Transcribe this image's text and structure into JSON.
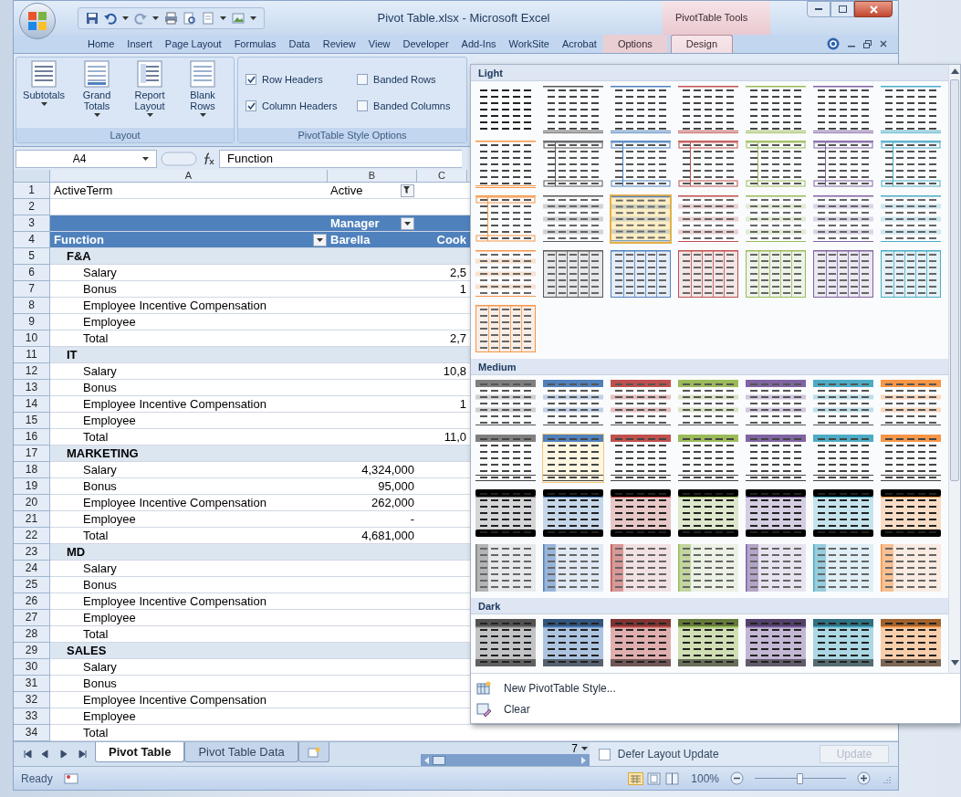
{
  "window": {
    "title": "Pivot Table.xlsx - Microsoft Excel",
    "context_title": "PivotTable Tools"
  },
  "tabs": [
    {
      "label": "Home",
      "selected": false,
      "contextual": false
    },
    {
      "label": "Insert",
      "selected": false,
      "contextual": false
    },
    {
      "label": "Page Layout",
      "selected": false,
      "contextual": false
    },
    {
      "label": "Formulas",
      "selected": false,
      "contextual": false
    },
    {
      "label": "Data",
      "selected": false,
      "contextual": false
    },
    {
      "label": "Review",
      "selected": false,
      "contextual": false
    },
    {
      "label": "View",
      "selected": false,
      "contextual": false
    },
    {
      "label": "Developer",
      "selected": false,
      "contextual": false
    },
    {
      "label": "Add-Ins",
      "selected": false,
      "contextual": false
    },
    {
      "label": "WorkSite",
      "selected": false,
      "contextual": false
    },
    {
      "label": "Acrobat",
      "selected": false,
      "contextual": false
    },
    {
      "label": "Options",
      "selected": false,
      "contextual": true
    },
    {
      "label": "Design",
      "selected": true,
      "contextual": true
    }
  ],
  "ribbon": {
    "layout_group": {
      "title": "Layout",
      "buttons": [
        {
          "label": "Subtotals"
        },
        {
          "label": "Grand Totals"
        },
        {
          "label": "Report Layout"
        },
        {
          "label": "Blank Rows"
        }
      ]
    },
    "style_options": {
      "title": "PivotTable Style Options",
      "options": [
        {
          "label": "Row Headers",
          "checked": true
        },
        {
          "label": "Banded Rows",
          "checked": false
        },
        {
          "label": "Column Headers",
          "checked": true
        },
        {
          "label": "Banded Columns",
          "checked": false
        }
      ]
    }
  },
  "formula_bar": {
    "name_box": "A4",
    "value": "Function"
  },
  "columns": [
    "A",
    "B",
    "C"
  ],
  "rows": [
    {
      "number": "1",
      "kind": "filter",
      "a": "ActiveTerm",
      "b": "Active"
    },
    {
      "number": "2",
      "kind": "blank"
    },
    {
      "number": "3",
      "kind": "header-top",
      "b": "Manager"
    },
    {
      "number": "4",
      "kind": "header",
      "a": "Function",
      "b": "Barella",
      "c": "Cook"
    },
    {
      "number": "5",
      "kind": "group",
      "a": "F&A"
    },
    {
      "number": "6",
      "kind": "item",
      "a": "Salary",
      "c": "2,5"
    },
    {
      "number": "7",
      "kind": "item",
      "a": "Bonus",
      "c": "1"
    },
    {
      "number": "8",
      "kind": "item",
      "a": "Employee Incentive Compensation"
    },
    {
      "number": "9",
      "kind": "item",
      "a": "Employee"
    },
    {
      "number": "10",
      "kind": "item",
      "a": "Total",
      "c": "2,7"
    },
    {
      "number": "11",
      "kind": "group",
      "a": "IT"
    },
    {
      "number": "12",
      "kind": "item",
      "a": "Salary",
      "c": "10,8"
    },
    {
      "number": "13",
      "kind": "item",
      "a": "Bonus"
    },
    {
      "number": "14",
      "kind": "item",
      "a": "Employee Incentive Compensation",
      "c": "1"
    },
    {
      "number": "15",
      "kind": "item",
      "a": "Employee"
    },
    {
      "number": "16",
      "kind": "item",
      "a": "Total",
      "c": "11,0"
    },
    {
      "number": "17",
      "kind": "group",
      "a": "MARKETING"
    },
    {
      "number": "18",
      "kind": "item",
      "a": "Salary",
      "b": "4,324,000"
    },
    {
      "number": "19",
      "kind": "item",
      "a": "Bonus",
      "b": "95,000"
    },
    {
      "number": "20",
      "kind": "item",
      "a": "Employee Incentive Compensation",
      "b": "262,000"
    },
    {
      "number": "21",
      "kind": "item",
      "a": "Employee",
      "b": "-"
    },
    {
      "number": "22",
      "kind": "item",
      "a": "Total",
      "b": "4,681,000"
    },
    {
      "number": "23",
      "kind": "group",
      "a": "MD"
    },
    {
      "number": "24",
      "kind": "item",
      "a": "Salary"
    },
    {
      "number": "25",
      "kind": "item",
      "a": "Bonus"
    },
    {
      "number": "26",
      "kind": "item",
      "a": "Employee Incentive Compensation"
    },
    {
      "number": "27",
      "kind": "item",
      "a": "Employee"
    },
    {
      "number": "28",
      "kind": "item",
      "a": "Total"
    },
    {
      "number": "29",
      "kind": "group",
      "a": "SALES"
    },
    {
      "number": "30",
      "kind": "item",
      "a": "Salary"
    },
    {
      "number": "31",
      "kind": "item",
      "a": "Bonus"
    },
    {
      "number": "32",
      "kind": "item",
      "a": "Employee Incentive Compensation"
    },
    {
      "number": "33",
      "kind": "item",
      "a": "Employee"
    },
    {
      "number": "34",
      "kind": "item",
      "a": "Total"
    }
  ],
  "sheet_tabs": [
    {
      "label": "Pivot Table",
      "selected": true
    },
    {
      "label": "Pivot Table Data",
      "selected": false
    }
  ],
  "field_list": {
    "value": "7",
    "defer_label": "Defer Layout Update",
    "defer_checked": false,
    "update_button": "Update",
    "update_disabled": true
  },
  "status_bar": {
    "status": "Ready",
    "zoom": "100%",
    "zoom_slider": {
      "level": 0.5
    }
  },
  "style_gallery": {
    "sections": [
      {
        "title": "Light",
        "styles": [
          {
            "kind": "none",
            "selected": false,
            "hovered": false
          },
          {
            "kind": "lines",
            "color": "#595959",
            "selected": false,
            "hovered": false
          },
          {
            "kind": "lines",
            "color": "#4f81bd",
            "selected": false,
            "hovered": false
          },
          {
            "kind": "lines",
            "color": "#c0504d",
            "selected": false,
            "hovered": false
          },
          {
            "kind": "lines",
            "color": "#9bbb59",
            "selected": false,
            "hovered": false
          },
          {
            "kind": "lines",
            "color": "#8064a2",
            "selected": false,
            "hovered": false
          },
          {
            "kind": "lines",
            "color": "#4bacc6",
            "selected": false,
            "hovered": false
          },
          {
            "kind": "lines",
            "color": "#f79646",
            "selected": false,
            "hovered": false
          },
          {
            "kind": "framed",
            "color": "#595959",
            "selected": false,
            "hovered": false
          },
          {
            "kind": "framed",
            "color": "#4f81bd",
            "selected": false,
            "hovered": false
          },
          {
            "kind": "framed",
            "color": "#c0504d",
            "selected": false,
            "hovered": false
          },
          {
            "kind": "framed",
            "color": "#9bbb59",
            "selected": false,
            "hovered": false
          },
          {
            "kind": "framed",
            "color": "#8064a2",
            "selected": false,
            "hovered": false
          },
          {
            "kind": "framed",
            "color": "#4bacc6",
            "selected": false,
            "hovered": false
          },
          {
            "kind": "framed",
            "color": "#f79646",
            "selected": false,
            "hovered": false
          },
          {
            "kind": "banded",
            "color": "#595959",
            "selected": false,
            "hovered": false
          },
          {
            "kind": "banded",
            "color": "#4f81bd",
            "selected": true,
            "hovered": false
          },
          {
            "kind": "banded",
            "color": "#c0504d",
            "selected": false,
            "hovered": false
          },
          {
            "kind": "banded",
            "color": "#9bbb59",
            "selected": false,
            "hovered": false
          },
          {
            "kind": "banded",
            "color": "#8064a2",
            "selected": false,
            "hovered": false
          },
          {
            "kind": "banded",
            "color": "#4bacc6",
            "selected": false,
            "hovered": false
          },
          {
            "kind": "banded",
            "color": "#f79646",
            "selected": false,
            "hovered": false
          },
          {
            "kind": "grid",
            "color": "#595959",
            "selected": false,
            "hovered": false
          },
          {
            "kind": "grid",
            "color": "#4f81bd",
            "selected": false,
            "hovered": false
          },
          {
            "kind": "grid",
            "color": "#c0504d",
            "selected": false,
            "hovered": false
          },
          {
            "kind": "grid",
            "color": "#9bbb59",
            "selected": false,
            "hovered": false
          },
          {
            "kind": "grid",
            "color": "#8064a2",
            "selected": false,
            "hovered": false
          },
          {
            "kind": "grid",
            "color": "#4bacc6",
            "selected": false,
            "hovered": false
          },
          {
            "kind": "grid",
            "color": "#f79646",
            "selected": false,
            "hovered": false
          }
        ]
      },
      {
        "title": "Medium",
        "styles": [
          {
            "kind": "header",
            "color": "#7f7f7f",
            "selected": false,
            "hovered": false
          },
          {
            "kind": "header",
            "color": "#4f81bd",
            "selected": false,
            "hovered": false
          },
          {
            "kind": "header",
            "color": "#c0504d",
            "selected": false,
            "hovered": false
          },
          {
            "kind": "header",
            "color": "#9bbb59",
            "selected": false,
            "hovered": false
          },
          {
            "kind": "header",
            "color": "#8064a2",
            "selected": false,
            "hovered": false
          },
          {
            "kind": "header",
            "color": "#4bacc6",
            "selected": false,
            "hovered": false
          },
          {
            "kind": "header",
            "color": "#f79646",
            "selected": false,
            "hovered": false
          },
          {
            "kind": "header2",
            "color": "#7f7f7f",
            "selected": false,
            "hovered": false
          },
          {
            "kind": "header2",
            "color": "#4f81bd",
            "selected": false,
            "hovered": true
          },
          {
            "kind": "header2",
            "color": "#c0504d",
            "selected": false,
            "hovered": false
          },
          {
            "kind": "header2",
            "color": "#9bbb59",
            "selected": false,
            "hovered": false
          },
          {
            "kind": "header2",
            "color": "#8064a2",
            "selected": false,
            "hovered": false
          },
          {
            "kind": "header2",
            "color": "#4bacc6",
            "selected": false,
            "hovered": false
          },
          {
            "kind": "header2",
            "color": "#f79646",
            "selected": false,
            "hovered": false
          },
          {
            "kind": "blackhead",
            "color": "#7f7f7f",
            "selected": false,
            "hovered": false
          },
          {
            "kind": "blackhead",
            "color": "#4f81bd",
            "selected": false,
            "hovered": false
          },
          {
            "kind": "blackhead",
            "color": "#c0504d",
            "selected": false,
            "hovered": false
          },
          {
            "kind": "blackhead",
            "color": "#9bbb59",
            "selected": false,
            "hovered": false
          },
          {
            "kind": "blackhead",
            "color": "#8064a2",
            "selected": false,
            "hovered": false
          },
          {
            "kind": "blackhead",
            "color": "#4bacc6",
            "selected": false,
            "hovered": false
          },
          {
            "kind": "blackhead",
            "color": "#f79646",
            "selected": false,
            "hovered": false
          },
          {
            "kind": "column",
            "color": "#7f7f7f",
            "selected": false,
            "hovered": false
          },
          {
            "kind": "column",
            "color": "#4f81bd",
            "selected": false,
            "hovered": false
          },
          {
            "kind": "column",
            "color": "#c0504d",
            "selected": false,
            "hovered": false
          },
          {
            "kind": "column",
            "color": "#9bbb59",
            "selected": false,
            "hovered": false
          },
          {
            "kind": "column",
            "color": "#8064a2",
            "selected": false,
            "hovered": false
          },
          {
            "kind": "column",
            "color": "#4bacc6",
            "selected": false,
            "hovered": false
          },
          {
            "kind": "column",
            "color": "#f79646",
            "selected": false,
            "hovered": false
          }
        ]
      },
      {
        "title": "Dark",
        "styles": [
          {
            "kind": "dark",
            "color": "#7f7f7f",
            "selected": false,
            "hovered": false
          },
          {
            "kind": "dark",
            "color": "#4f81bd",
            "selected": false,
            "hovered": false
          },
          {
            "kind": "dark",
            "color": "#c0504d",
            "selected": false,
            "hovered": false
          },
          {
            "kind": "dark",
            "color": "#9bbb59",
            "selected": false,
            "hovered": false
          },
          {
            "kind": "dark",
            "color": "#8064a2",
            "selected": false,
            "hovered": false
          },
          {
            "kind": "dark",
            "color": "#4bacc6",
            "selected": false,
            "hovered": false
          },
          {
            "kind": "dark",
            "color": "#f79646",
            "selected": false,
            "hovered": false
          }
        ]
      }
    ],
    "menu": [
      {
        "label": "New PivotTable Style..."
      },
      {
        "label": "Clear"
      }
    ]
  }
}
